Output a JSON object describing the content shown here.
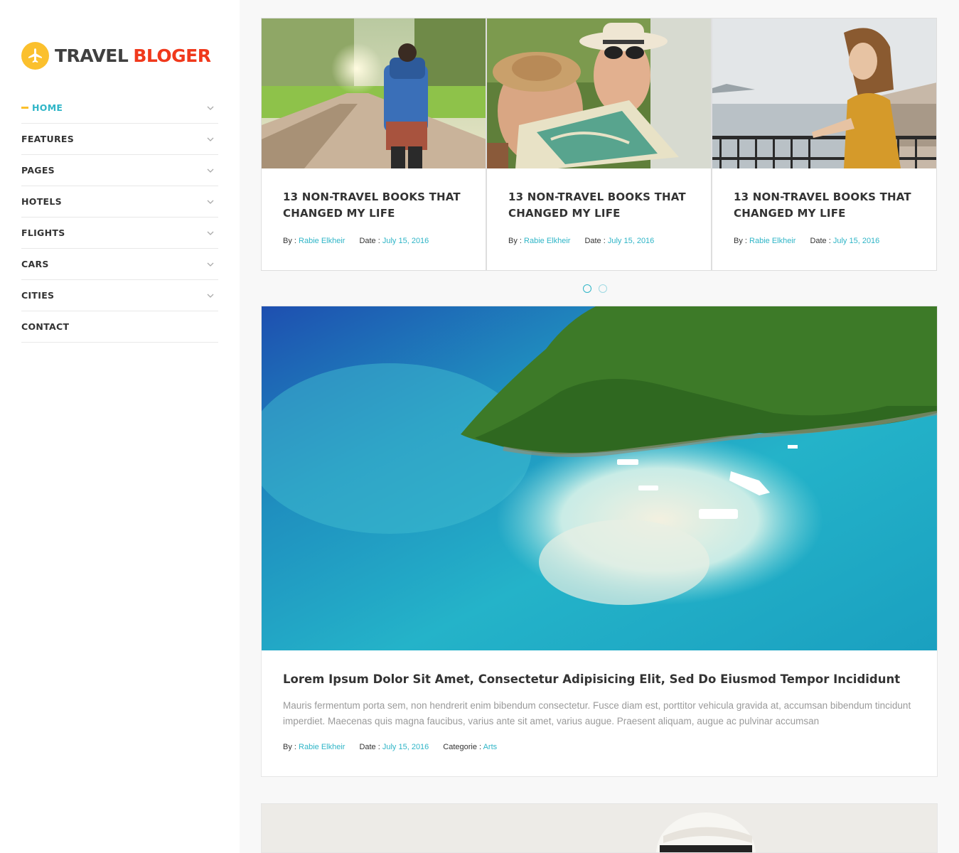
{
  "brand": {
    "word1": "TRAVEL",
    "word2": "BLOGER"
  },
  "colors": {
    "accent": "#2fb5c7",
    "brand_yellow": "#fbc02d",
    "brand_red": "#f0391c"
  },
  "nav": [
    {
      "label": "HOME",
      "active": true,
      "has_submenu": true
    },
    {
      "label": "FEATURES",
      "active": false,
      "has_submenu": true
    },
    {
      "label": "PAGES",
      "active": false,
      "has_submenu": true
    },
    {
      "label": "HOTELS",
      "active": false,
      "has_submenu": true
    },
    {
      "label": "FLIGHTS",
      "active": false,
      "has_submenu": true
    },
    {
      "label": "CARS",
      "active": false,
      "has_submenu": true
    },
    {
      "label": "CITIES",
      "active": false,
      "has_submenu": true
    },
    {
      "label": "CONTACT",
      "active": false,
      "has_submenu": false
    }
  ],
  "slider": {
    "cards": [
      {
        "title": "13 NON-TRAVEL BOOKS THAT CHANGED MY LIFE",
        "by_label": "By :",
        "author": "Rabie Elkheir",
        "date_label": "Date :",
        "date": "July 15, 2016",
        "image": "hiker-photo"
      },
      {
        "title": "13 NON-TRAVEL BOOKS THAT CHANGED MY LIFE",
        "by_label": "By :",
        "author": "Rabie Elkheir",
        "date_label": "Date :",
        "date": "July 15, 2016",
        "image": "couple-map-photo"
      },
      {
        "title": "13 NON-TRAVEL BOOKS THAT CHANGED MY LIFE",
        "by_label": "By :",
        "author": "Rabie Elkheir",
        "date_label": "Date :",
        "date": "July 15, 2016",
        "image": "woman-balcony-photo"
      }
    ],
    "pages": 2,
    "current_page": 1
  },
  "post": {
    "title": "Lorem Ipsum Dolor Sit Amet, Consectetur Adipisicing Elit, Sed Do Eiusmod Tempor Incididunt",
    "excerpt": "Mauris fermentum porta sem, non hendrerit enim bibendum consectetur. Fusce diam est, porttitor vehicula gravida at, accumsan bibendum tincidunt imperdiet. Maecenas quis magna faucibus, varius ante sit amet, varius augue. Praesent aliquam, augue ac pulvinar accumsan",
    "by_label": "By :",
    "author": "Rabie Elkheir",
    "date_label": "Date :",
    "date": "July 15, 2016",
    "category_label": "Categorie :",
    "category": "Arts",
    "image": "island-aerial-photo"
  },
  "next_post": {
    "image": "hat-photo"
  }
}
